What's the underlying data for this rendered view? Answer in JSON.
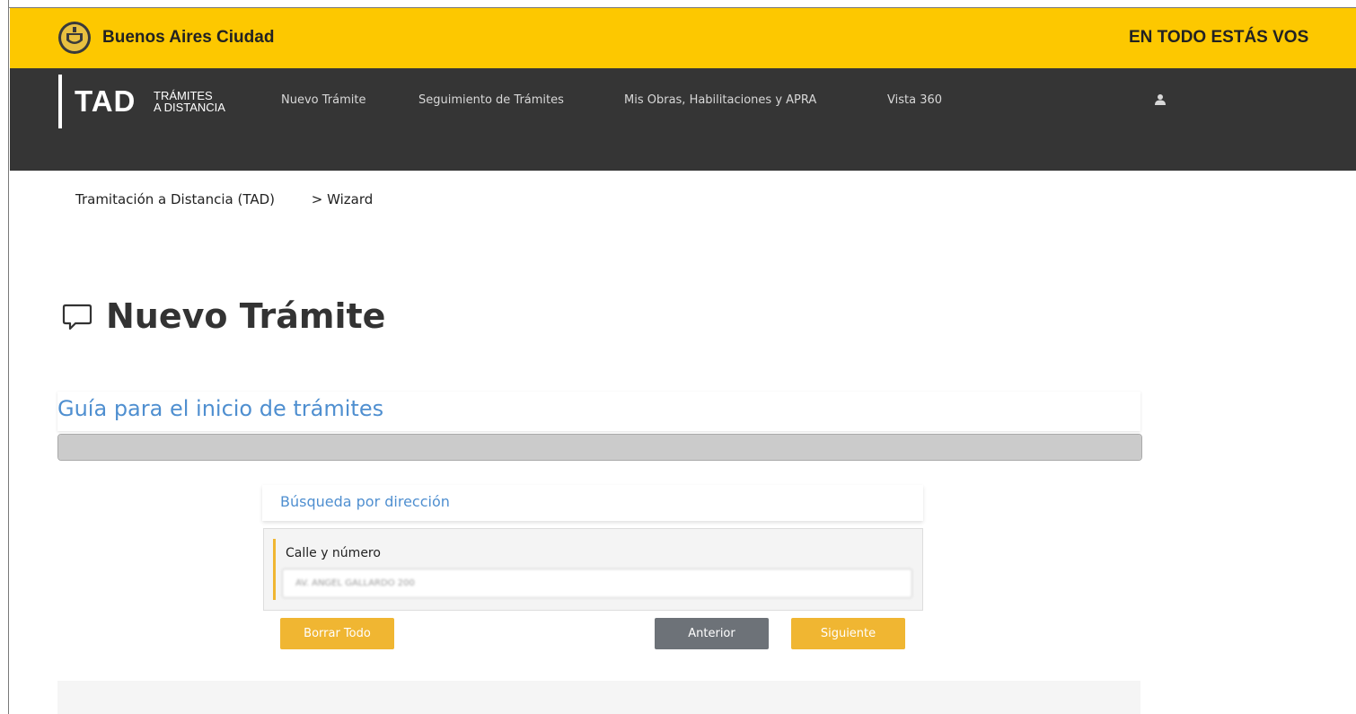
{
  "city_bar": {
    "name": "Buenos Aires Ciudad",
    "slogan": "EN TODO ESTÁS VOS",
    "background_color": "#fdc800",
    "logo_icon": "city-shield-icon"
  },
  "nav": {
    "logo_main": "TAD",
    "logo_line1": "TRÁMITES",
    "logo_line2": "A DISTANCIA",
    "links": [
      "Nuevo Trámite",
      "Seguimiento de Trámites",
      "Mis Obras, Habilitaciones y APRA",
      "Vista 360"
    ],
    "user_icon": "user-icon",
    "background_color": "#353535"
  },
  "breadcrumb": {
    "root": "Tramitación a Distancia (TAD)",
    "current": "> Wizard"
  },
  "page": {
    "title": "Nuevo Trámite",
    "title_icon": "speech-bubble-icon"
  },
  "guide": {
    "title": "Guía para el inicio de trámites",
    "accent_color": "#4f8fd0"
  },
  "address_search": {
    "title": "Búsqueda por dirección",
    "field_label": "Calle y número",
    "field_value": "AV. ANGEL GALLARDO 200"
  },
  "buttons": {
    "clear": "Borrar Todo",
    "previous": "Anterior",
    "next": "Siguiente",
    "primary_color": "#f0b632",
    "secondary_color": "#6d7278"
  }
}
